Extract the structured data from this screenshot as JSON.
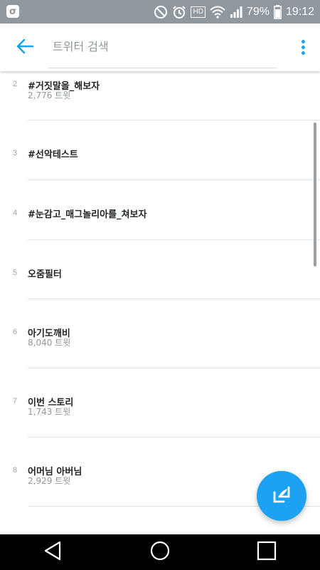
{
  "status_bar": {
    "battery": "79%",
    "time": "19:12",
    "network_label": "HD",
    "icons": [
      "app-badge-icon",
      "do-not-disturb-icon",
      "alarm-icon",
      "hd-icon",
      "wifi-icon",
      "signal-icon",
      "battery-icon"
    ]
  },
  "header": {
    "search_placeholder": "트위터 검색",
    "back_icon": "back-arrow-icon",
    "menu_icon": "more-vert-icon",
    "accent": "#1da1f2"
  },
  "trends": [
    {
      "rank": "2",
      "name": "#거짓말을_해보자",
      "count": "2,776 트윗"
    },
    {
      "rank": "3",
      "name": "#선악테스트",
      "count": ""
    },
    {
      "rank": "4",
      "name": "#눈감고_매그놀리아를_쳐보자",
      "count": ""
    },
    {
      "rank": "5",
      "name": "오줌필터",
      "count": ""
    },
    {
      "rank": "6",
      "name": "아기도깨비",
      "count": "8,040 트윗"
    },
    {
      "rank": "7",
      "name": "이번 스토리",
      "count": "1,743 트윗"
    },
    {
      "rank": "8",
      "name": "어머님 아버님",
      "count": "2,929 트윗"
    }
  ],
  "fab": {
    "icon": "compose-tweet-icon"
  },
  "nav": {
    "icons": [
      "nav-back-icon",
      "nav-home-icon",
      "nav-recents-icon"
    ]
  }
}
